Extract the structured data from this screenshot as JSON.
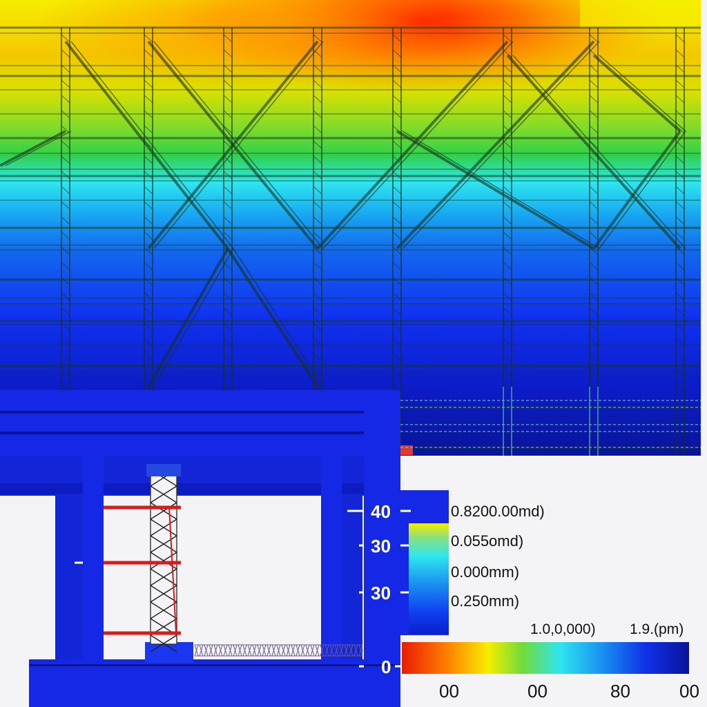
{
  "colors": {
    "hot": "#ff1a00",
    "warm": "#ff8a00",
    "yellow": "#f6ee00",
    "green": "#2fd14a",
    "cyan": "#2ee6f0",
    "blue": "#1030f0",
    "navy": "#0a149a",
    "structure_base": "#1428e6",
    "red_member": "#d81b1b"
  },
  "left_axis": {
    "ticks": [
      "40",
      "30",
      "30",
      "0"
    ]
  },
  "vertical_legend": {
    "labels": [
      "0.8200.00md)",
      "0.055omd)",
      "0.000mm)",
      "0.250mm)"
    ]
  },
  "horizontal_colorbar": {
    "top_labels": [
      "1.0,0,000)",
      "1.9.(pm)"
    ],
    "bottom_ticks": [
      "00",
      "00",
      "80",
      "00"
    ]
  }
}
